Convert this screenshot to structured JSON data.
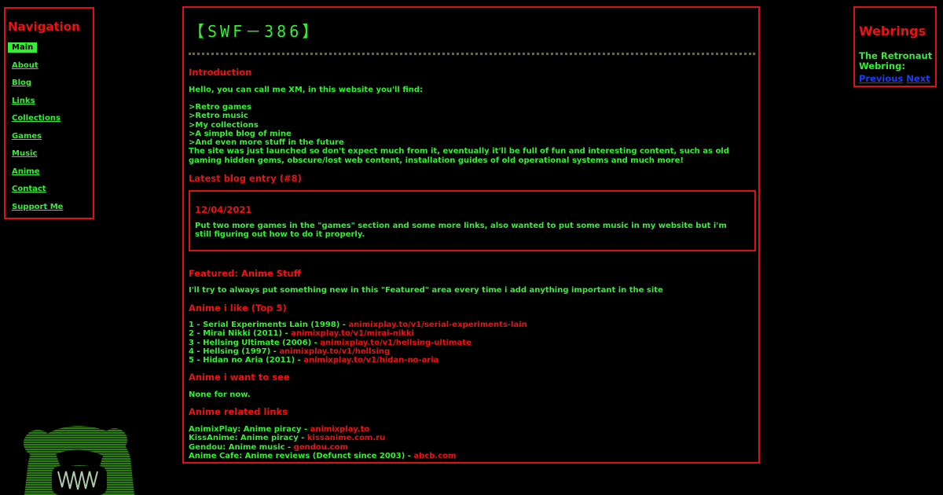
{
  "nav": {
    "title": "Navigation",
    "items": [
      "Main",
      "About",
      "Blog",
      "Links",
      "Collections",
      "Games",
      "Music",
      "Anime",
      "Contact",
      "Support Me"
    ]
  },
  "main": {
    "site_title": "【SWF－386】",
    "intro": {
      "heading": "Introduction",
      "greeting": "Hello, you can call me XM, in this website you'll find:",
      "list": [
        ">Retro games",
        ">Retro music",
        ">My collections",
        ">A simple blog of mine",
        ">And even more stuff in the future"
      ],
      "note": "The site was just launched so don't expect much from it, eventually it'll be full of fun and interesting content, such as old gaming hidden gems, obscure/lost web content, installation guides of old operational systems and much more!"
    },
    "blog": {
      "heading": "Latest blog entry (#8)",
      "date": "12/04/2021",
      "text": "Put two more games in the \"games\" section and some more links, also wanted to put some music in my website but i'm still figuring out how to do it properly."
    },
    "featured": {
      "heading": "Featured: Anime Stuff",
      "text": "I'll try to always put something new in this \"Featured\" area every time i add anything important in the site"
    },
    "anime_like": {
      "heading": "Anime i like (Top 5)",
      "items": [
        {
          "label": "1 - Serial Experiments Lain (1998) - ",
          "link": "animixplay.to/v1/serial-experiments-lain"
        },
        {
          "label": "2 - Mirai Nikki (2011) - ",
          "link": "animixplay.to/v1/mirai-nikki"
        },
        {
          "label": "3 - Hellsing Ultimate (2006) - ",
          "link": "animixplay.to/v1/hellsing-ultimate"
        },
        {
          "label": "4 - Hellsing (1997) - ",
          "link": "animixplay.to/v1/hellsing"
        },
        {
          "label": "5 - Hidan no Aria (2011) - ",
          "link": "animixplay.to/v1/hidan-no-aria"
        }
      ]
    },
    "anime_want": {
      "heading": "Anime i want to see",
      "text": "None for now."
    },
    "anime_links": {
      "heading": "Anime related links",
      "items": [
        {
          "label": "AnimixPlay: Anime piracy - ",
          "link": "animixplay.to"
        },
        {
          "label": "KissAnime: Anime piracy - ",
          "link": "kissanime.com.ru"
        },
        {
          "label": "Gendou: Anime music - ",
          "link": "gendou.com"
        },
        {
          "label": "Anime Cafe: Anime reviews (Defunct since 2003) - ",
          "link": "abcb.com"
        }
      ]
    }
  },
  "webrings": {
    "title": "Webrings",
    "name": "The Retronaut Webring:",
    "previous": "Previous",
    "next": "Next"
  },
  "colors": {
    "green": "#33ee33",
    "red": "#ee1111",
    "link_blue": "#1a3fee",
    "background": "#000000"
  },
  "icons": {
    "mascot": "bear-mascot-icon"
  }
}
